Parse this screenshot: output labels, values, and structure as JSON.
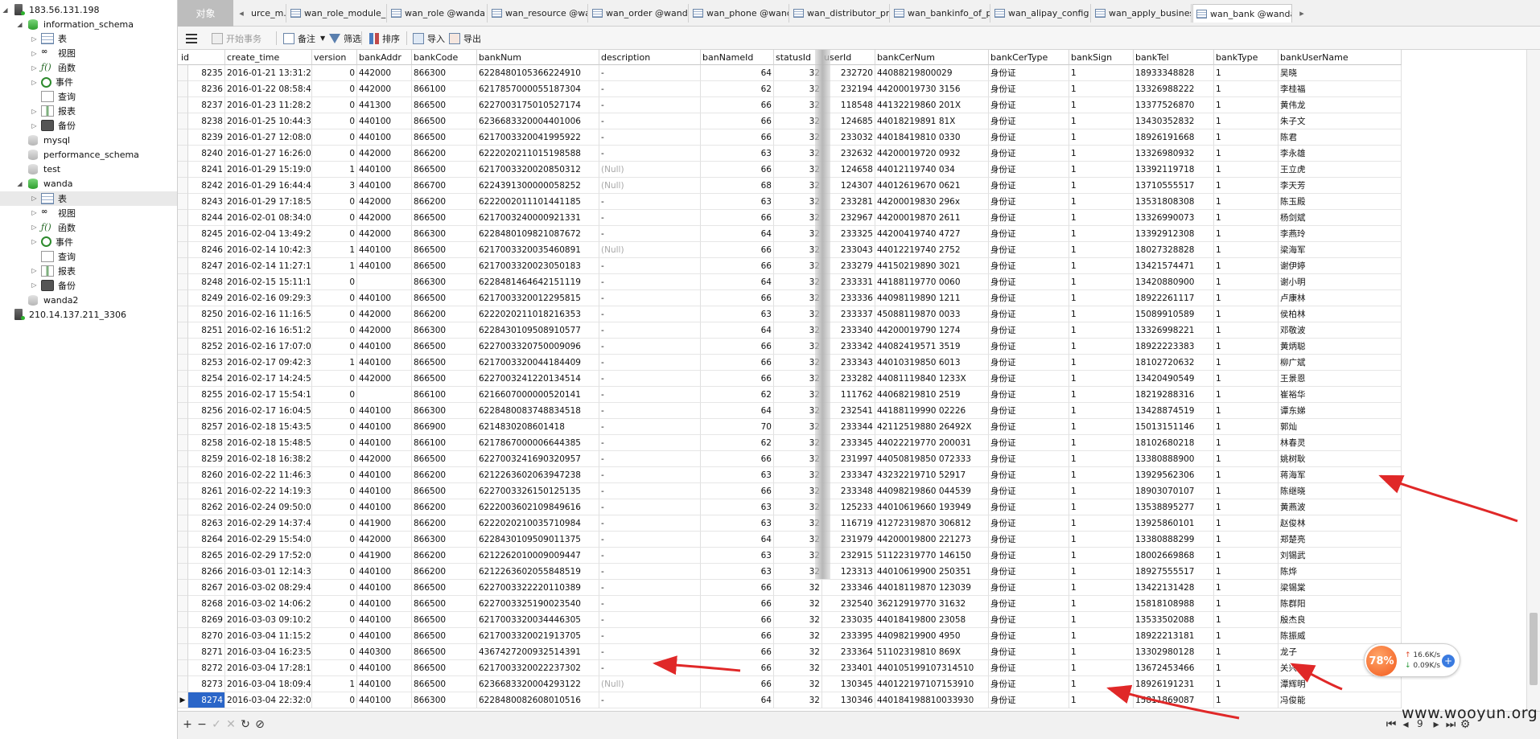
{
  "sidebar": {
    "servers": [
      {
        "name": "183.56.131.198",
        "databases": [
          {
            "name": "information_schema",
            "expanded": true,
            "children": [
              "表",
              "视图",
              "函数",
              "事件",
              "查询",
              "报表",
              "备份"
            ]
          },
          {
            "name": "mysql"
          },
          {
            "name": "performance_schema"
          },
          {
            "name": "test"
          },
          {
            "name": "wanda",
            "expanded": true,
            "children": [
              "表",
              "视图",
              "函数",
              "事件",
              "查询",
              "报表",
              "备份"
            ]
          },
          {
            "name": "wanda2"
          }
        ]
      },
      {
        "name": "210.14.137.211_3306"
      }
    ]
  },
  "tabs": {
    "objects_label": "对象",
    "items": [
      "urce_m...",
      "wan_role_module_m...",
      "wan_role @wanda (1...",
      "wan_resource @wan...",
      "wan_order @wanda (...",
      "wan_phone @wanda ...",
      "wan_distributor_prod...",
      "wan_bankinfo_of_ph...",
      "wan_alipay_config @...",
      "wan_apply_business ...",
      "wan_bank @wanda (..."
    ],
    "active_index": 10
  },
  "toolbar": {
    "begin_tx": "开始事务",
    "note": "备注",
    "filter": "筛选",
    "sort": "排序",
    "import": "导入",
    "export": "导出"
  },
  "grid": {
    "columns": [
      "id",
      "create_time",
      "version",
      "bankAddr",
      "bankCode",
      "bankNum",
      "description",
      "banNameId",
      "statusId",
      "userId",
      "bankCerNum",
      "bankCerType",
      "bankSign",
      "bankTel",
      "bankType",
      "bankUserName"
    ],
    "rows": [
      [
        "8235",
        "2016-01-21 13:31:25",
        "0",
        "442000",
        "866300",
        "6228480105366224910",
        "-",
        "64",
        "32",
        "232720",
        "44088219800029",
        "身份证",
        "1",
        "18933348828",
        "1",
        "吴晓"
      ],
      [
        "8236",
        "2016-01-22 08:58:41",
        "0",
        "442000",
        "866100",
        "6217857000055187304",
        "-",
        "62",
        "32",
        "232194",
        "44200019730 3156",
        "身份证",
        "1",
        "13326988222",
        "1",
        "李桂福"
      ],
      [
        "8237",
        "2016-01-23 11:28:29",
        "0",
        "441300",
        "866500",
        "6227003175010527174",
        "-",
        "66",
        "32",
        "118548",
        "44132219860 201X",
        "身份证",
        "1",
        "13377526870",
        "1",
        "黄伟龙"
      ],
      [
        "8238",
        "2016-01-25 10:44:31",
        "0",
        "440100",
        "866500",
        "6236683320004401006",
        "-",
        "66",
        "32",
        "124685",
        "44018219891 81X",
        "身份证",
        "1",
        "13430352832",
        "1",
        "朱子文"
      ],
      [
        "8239",
        "2016-01-27 12:08:03",
        "0",
        "440100",
        "866500",
        "6217003320041995922",
        "-",
        "66",
        "32",
        "233032",
        "44018419810 0330",
        "身份证",
        "1",
        "18926191668",
        "1",
        "陈君"
      ],
      [
        "8240",
        "2016-01-27 16:26:05",
        "0",
        "442000",
        "866200",
        "6222020211015198588",
        "-",
        "63",
        "32",
        "232632",
        "44200019720 0932",
        "身份证",
        "1",
        "13326980932",
        "1",
        "李永雄"
      ],
      [
        "8241",
        "2016-01-29 15:19:01",
        "1",
        "440100",
        "866500",
        "6217003320020850312",
        "(Null)",
        "66",
        "32",
        "124658",
        "44012119740 034",
        "身份证",
        "1",
        "13392119718",
        "1",
        "王立虎"
      ],
      [
        "8242",
        "2016-01-29 16:44:41",
        "3",
        "440100",
        "866700",
        "6224391300000058252",
        "(Null)",
        "68",
        "32",
        "124307",
        "44012619670 0621",
        "身份证",
        "1",
        "13710555517",
        "1",
        "李天芳"
      ],
      [
        "8243",
        "2016-01-29 17:18:50",
        "0",
        "442000",
        "866200",
        "6222002011101441185",
        "-",
        "63",
        "32",
        "233281",
        "44200019830 296x",
        "身份证",
        "1",
        "13531808308",
        "1",
        "陈玉殿"
      ],
      [
        "8244",
        "2016-02-01 08:34:00",
        "0",
        "442000",
        "866500",
        "6217003240000921331",
        "-",
        "66",
        "32",
        "232967",
        "44200019870 2611",
        "身份证",
        "1",
        "13326990073",
        "1",
        "杨剑斌"
      ],
      [
        "8245",
        "2016-02-04 13:49:20",
        "0",
        "442000",
        "866300",
        "6228480109821087672",
        "-",
        "64",
        "32",
        "233325",
        "44200419740 4727",
        "身份证",
        "1",
        "13392912308",
        "1",
        "李燕玲"
      ],
      [
        "8246",
        "2016-02-14 10:42:31",
        "1",
        "440100",
        "866500",
        "6217003320035460891",
        "(Null)",
        "66",
        "32",
        "233043",
        "44012219740 2752",
        "身份证",
        "1",
        "18027328828",
        "1",
        "梁海军"
      ],
      [
        "8247",
        "2016-02-14 11:27:19",
        "1",
        "440100",
        "866500",
        "6217003320023050183",
        "-",
        "66",
        "32",
        "233279",
        "44150219890 3021",
        "身份证",
        "1",
        "13421574471",
        "1",
        "谢伊婷"
      ],
      [
        "8248",
        "2016-02-15 15:11:18",
        "0",
        "",
        "866300",
        "6228481464642151119",
        "-",
        "64",
        "32",
        "233331",
        "44188119770 0060",
        "身份证",
        "1",
        "13420880900",
        "1",
        "谢小明"
      ],
      [
        "8249",
        "2016-02-16 09:29:32",
        "0",
        "440100",
        "866500",
        "6217003320012295815",
        "-",
        "66",
        "32",
        "233336",
        "44098119890 1211",
        "身份证",
        "1",
        "18922261117",
        "1",
        "卢康林"
      ],
      [
        "8250",
        "2016-02-16 11:16:54",
        "0",
        "442000",
        "866200",
        "6222020211018216353",
        "-",
        "63",
        "32",
        "233337",
        "45088119870 0033",
        "身份证",
        "1",
        "15089910589",
        "1",
        "侯柏林"
      ],
      [
        "8251",
        "2016-02-16 16:51:24",
        "0",
        "442000",
        "866300",
        "6228430109508910577",
        "-",
        "64",
        "32",
        "233340",
        "44200019790 1274",
        "身份证",
        "1",
        "13326998221",
        "1",
        "邓敬波"
      ],
      [
        "8252",
        "2016-02-16 17:07:03",
        "0",
        "440100",
        "866500",
        "6227003320750009096",
        "-",
        "66",
        "32",
        "233342",
        "44082419571 3519",
        "身份证",
        "1",
        "18922223383",
        "1",
        "黄炳聪"
      ],
      [
        "8253",
        "2016-02-17 09:42:39",
        "1",
        "440100",
        "866500",
        "6217003320044184409",
        "-",
        "66",
        "32",
        "233343",
        "44010319850 6013",
        "身份证",
        "1",
        "18102720632",
        "1",
        "柳广斌"
      ],
      [
        "8254",
        "2016-02-17 14:24:59",
        "0",
        "442000",
        "866500",
        "6227003241220134514",
        "-",
        "66",
        "32",
        "233282",
        "44081119840 1233X",
        "身份证",
        "1",
        "13420490549",
        "1",
        "王景恩"
      ],
      [
        "8255",
        "2016-02-17 15:54:18",
        "0",
        "",
        "866100",
        "6216607000000520141",
        "-",
        "62",
        "32",
        "111762",
        "44068219810 2519",
        "身份证",
        "1",
        "18219288316",
        "1",
        "崔裕华"
      ],
      [
        "8256",
        "2016-02-17 16:04:58",
        "0",
        "440100",
        "866300",
        "6228480083748834518",
        "-",
        "64",
        "32",
        "232541",
        "44188119990 02226",
        "身份证",
        "1",
        "13428874519",
        "1",
        "谭东娣"
      ],
      [
        "8257",
        "2016-02-18 15:43:58",
        "0",
        "440100",
        "866900",
        "6214830208601418",
        "-",
        "70",
        "32",
        "233344",
        "42112519880 26492X",
        "身份证",
        "1",
        "15013151146",
        "1",
        "郭灿"
      ],
      [
        "8258",
        "2016-02-18 15:48:53",
        "0",
        "440100",
        "866100",
        "6217867000006644385",
        "-",
        "62",
        "32",
        "233345",
        "44022219770 200031",
        "身份证",
        "1",
        "18102680218",
        "1",
        "林春灵"
      ],
      [
        "8259",
        "2016-02-18 16:38:27",
        "0",
        "442000",
        "866500",
        "6227003241690320957",
        "-",
        "66",
        "32",
        "231997",
        "44050819850 072333",
        "身份证",
        "1",
        "13380888900",
        "1",
        "姚树耿"
      ],
      [
        "8260",
        "2016-02-22 11:46:32",
        "0",
        "440100",
        "866200",
        "6212263602063947238",
        "-",
        "63",
        "32",
        "233347",
        "43232219710 52917",
        "身份证",
        "1",
        "13929562306",
        "1",
        "蒋海军"
      ],
      [
        "8261",
        "2016-02-22 14:19:39",
        "0",
        "440100",
        "866500",
        "6227003326150125135",
        "-",
        "66",
        "32",
        "233348",
        "44098219860 044539",
        "身份证",
        "1",
        "18903070107",
        "1",
        "陈继晓"
      ],
      [
        "8262",
        "2016-02-24 09:50:04",
        "0",
        "440100",
        "866200",
        "6222003602109849616",
        "-",
        "63",
        "32",
        "125233",
        "44010619660 193949",
        "身份证",
        "1",
        "13538895277",
        "1",
        "黄燕波"
      ],
      [
        "8263",
        "2016-02-29 14:37:43",
        "0",
        "441900",
        "866200",
        "6222020210035710984",
        "-",
        "63",
        "32",
        "116719",
        "41272319870 306812",
        "身份证",
        "1",
        "13925860101",
        "1",
        "赵俊林"
      ],
      [
        "8264",
        "2016-02-29 15:54:00",
        "0",
        "442000",
        "866300",
        "6228430109509011375",
        "-",
        "64",
        "32",
        "231979",
        "44200019800 221273",
        "身份证",
        "1",
        "13380888299",
        "1",
        "郑楚亮"
      ],
      [
        "8265",
        "2016-02-29 17:52:01",
        "0",
        "441900",
        "866200",
        "6212262010009009447",
        "-",
        "63",
        "32",
        "232915",
        "51122319770 146150",
        "身份证",
        "1",
        "18002669868",
        "1",
        "刘锡武"
      ],
      [
        "8266",
        "2016-03-01 12:14:39",
        "0",
        "440100",
        "866200",
        "6212263602055848519",
        "-",
        "63",
        "32",
        "123313",
        "44010619900 250351",
        "身份证",
        "1",
        "18927555517",
        "1",
        "陈烨"
      ],
      [
        "8267",
        "2016-03-02 08:29:44",
        "0",
        "440100",
        "866500",
        "6227003322220110389",
        "-",
        "66",
        "32",
        "233346",
        "44018119870 123039",
        "身份证",
        "1",
        "13422131428",
        "1",
        "梁锡棠"
      ],
      [
        "8268",
        "2016-03-02 14:06:20",
        "0",
        "440100",
        "866500",
        "6227003325190023540",
        "-",
        "66",
        "32",
        "232540",
        "36212919770 31632",
        "身份证",
        "1",
        "15818108988",
        "1",
        "陈群阳"
      ],
      [
        "8269",
        "2016-03-03 09:10:27",
        "0",
        "440100",
        "866500",
        "6217003320034446305",
        "-",
        "66",
        "32",
        "233035",
        "44018419800 23058",
        "身份证",
        "1",
        "13533502088",
        "1",
        "殷杰良"
      ],
      [
        "8270",
        "2016-03-04 11:15:20",
        "0",
        "440100",
        "866500",
        "6217003320021913705",
        "-",
        "66",
        "32",
        "233395",
        "44098219900 4950",
        "身份证",
        "1",
        "18922213181",
        "1",
        "陈振威"
      ],
      [
        "8271",
        "2016-03-04 16:23:54",
        "0",
        "440300",
        "866500",
        "4367427200932514391",
        "-",
        "66",
        "32",
        "233364",
        "51102319810 869X",
        "身份证",
        "1",
        "13302980128",
        "1",
        "龙子"
      ],
      [
        "8272",
        "2016-03-04 17:28:13",
        "0",
        "440100",
        "866500",
        "6217003320022237302",
        "-",
        "66",
        "32",
        "233401",
        "440105199107314510",
        "身份证",
        "1",
        "13672453466",
        "1",
        "关兴"
      ],
      [
        "8273",
        "2016-03-04 18:09:46",
        "1",
        "440100",
        "866500",
        "6236683320004293122",
        "(Null)",
        "66",
        "32",
        "130345",
        "440122197107153910",
        "身份证",
        "1",
        "18926191231",
        "1",
        "潭辉明"
      ],
      [
        "8274",
        "2016-03-04 22:32:00",
        "0",
        "440100",
        "866300",
        "6228480082608010516",
        "-",
        "64",
        "32",
        "130346",
        "440184198810033930",
        "身份证",
        "1",
        "15811869087",
        "1",
        "冯俊能"
      ]
    ],
    "null_label": "(Null)",
    "selected_row_index": 39
  },
  "bottombar": {
    "page": "9"
  },
  "network_widget": {
    "percent": "78%",
    "up": "16.6K/s",
    "down": "0.09K/s"
  },
  "watermark": "www.wooyun.org",
  "colors": {
    "selection": "#2b66c8",
    "annotation_arrow": "#e02828",
    "widget_orange": "#f2591d"
  }
}
